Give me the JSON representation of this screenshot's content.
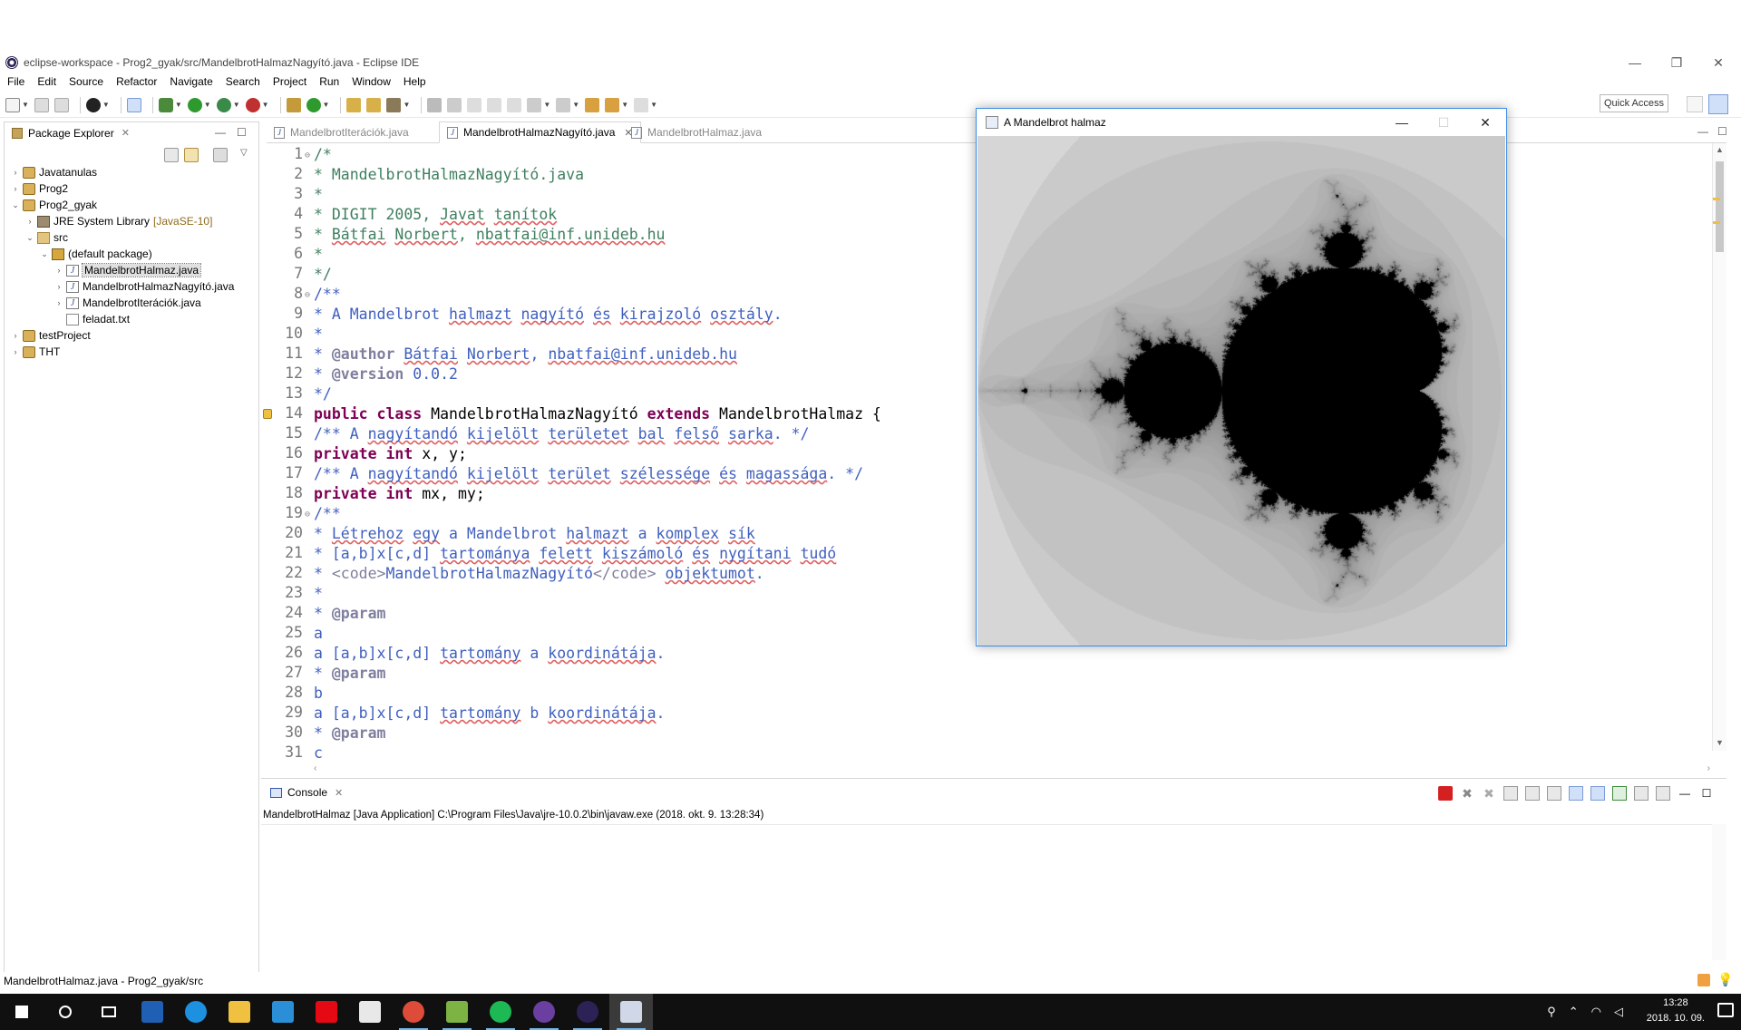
{
  "window": {
    "title": "eclipse-workspace - Prog2_gyak/src/MandelbrotHalmazNagyító.java - Eclipse IDE",
    "minimize": "—",
    "restore": "❐",
    "close": "✕"
  },
  "menu": [
    "File",
    "Edit",
    "Source",
    "Refactor",
    "Navigate",
    "Search",
    "Project",
    "Run",
    "Window",
    "Help"
  ],
  "toolbar": {
    "quick_access": "Quick Access"
  },
  "package_explorer": {
    "title": "Package Explorer",
    "items": [
      {
        "label": "Javatanulas",
        "arrow": "›",
        "icon": "project-icon",
        "level": 0
      },
      {
        "label": "Prog2",
        "arrow": "›",
        "icon": "project-icon",
        "level": 0
      },
      {
        "label": "Prog2_gyak",
        "arrow": "⌄",
        "icon": "project-icon",
        "level": 0
      },
      {
        "label": "JRE System Library",
        "suffix": "[JavaSE-10]",
        "arrow": "›",
        "icon": "library-icon",
        "level": 1
      },
      {
        "label": "src",
        "arrow": "⌄",
        "icon": "source-folder-icon",
        "level": 1
      },
      {
        "label": "(default package)",
        "arrow": "⌄",
        "icon": "package-icon",
        "level": 2
      },
      {
        "label": "MandelbrotHalmaz.java",
        "arrow": "›",
        "icon": "java-file-icon",
        "level": 3,
        "selected": true
      },
      {
        "label": "MandelbrotHalmazNagyító.java",
        "arrow": "›",
        "icon": "java-file-icon",
        "level": 3
      },
      {
        "label": "MandelbrotIterációk.java",
        "arrow": "›",
        "icon": "java-file-icon",
        "level": 3
      },
      {
        "label": "feladat.txt",
        "arrow": "",
        "icon": "text-file-icon",
        "level": 3
      },
      {
        "label": "testProject",
        "arrow": "›",
        "icon": "project-icon",
        "level": 0
      },
      {
        "label": "THT",
        "arrow": "›",
        "icon": "project-icon",
        "level": 0
      }
    ]
  },
  "editor_tabs": [
    {
      "label": "MandelbrotIterációk.java",
      "active": false
    },
    {
      "label": "MandelbrotHalmazNagyító.java",
      "active": true
    },
    {
      "label": "MandelbrotHalmaz.java",
      "active": false
    }
  ],
  "code_lines": [
    {
      "n": "1",
      "fold": "⊖",
      "html": "<span class='cmg'>/*</span>"
    },
    {
      "n": "2",
      "html": "<span class='cmg'>* MandelbrotHalmazNagyító.java</span>"
    },
    {
      "n": "3",
      "html": "<span class='cmg'>*</span>"
    },
    {
      "n": "4",
      "html": "<span class='cmg'>* DIGIT 2005, <span class='sq'>Javat</span> <span class='sq'>tanítok</span></span>"
    },
    {
      "n": "5",
      "html": "<span class='cmg'>* <span class='sq'>Bátfai</span> <span class='sq'>Norbert</span>, <span class='sq'>nbatfai@inf.unideb.hu</span></span>"
    },
    {
      "n": "6",
      "html": "<span class='cmg'>*</span>"
    },
    {
      "n": "7",
      "html": "<span class='cmg'>*/</span>"
    },
    {
      "n": "8",
      "fold": "⊖",
      "html": "<span class='cm'>/**</span>"
    },
    {
      "n": "9",
      "html": "<span class='cm'>* A Mandelbrot <span class='sq'>halmazt</span> <span class='sq'>nagyító</span> <span class='sq'>és</span> <span class='sq'>kirajzoló</span> <span class='sq'>osztály</span>.</span>"
    },
    {
      "n": "10",
      "html": "<span class='cm'>*</span>"
    },
    {
      "n": "11",
      "html": "<span class='cm'>* <b class='tag'>@author</b> <span class='sq'>Bátfai</span> <span class='sq'>Norbert</span>, <span class='sq'>nbatfai@inf.unideb.hu</span></span>"
    },
    {
      "n": "12",
      "html": "<span class='cm'>* <b class='tag'>@version</b> 0.0.2</span>"
    },
    {
      "n": "13",
      "html": "<span class='cm'>*/</span>"
    },
    {
      "n": "14",
      "marker": true,
      "html": "<span class='kw'>public</span> <span class='kw'>class</span> MandelbrotHalmazNagyító <span class='kw'>extends</span> MandelbrotHalmaz {"
    },
    {
      "n": "15",
      "html": "<span class='cm'>/** A <span class='sq'>nagyítandó</span> <span class='sq'>kijelölt</span> <span class='sq'>területet</span> <span class='sq'>bal</span> <span class='sq'>felső</span> <span class='sq'>sarka</span>. */</span>"
    },
    {
      "n": "16",
      "html": "<span class='kw'>private</span> <span class='kw'>int</span> x, y;"
    },
    {
      "n": "17",
      "html": "<span class='cm'>/** A <span class='sq'>nagyítandó</span> <span class='sq'>kijelölt</span> <span class='sq'>terület</span> <span class='sq'>szélessége</span> <span class='sq'>és</span> <span class='sq'>magassága</span>. */</span>"
    },
    {
      "n": "18",
      "html": "<span class='kw'>private</span> <span class='kw'>int</span> mx, my;"
    },
    {
      "n": "19",
      "fold": "⊖",
      "html": "<span class='cm'>/**</span>"
    },
    {
      "n": "20",
      "html": "<span class='cm'>* <span class='sq'>Létrehoz</span> <span class='sq'>egy</span> a Mandelbrot <span class='sq'>halmazt</span> a <span class='sq'>komplex</span> <span class='sq'>sík</span></span>"
    },
    {
      "n": "21",
      "html": "<span class='cm'>* [a,b]x[c,d] <span class='sq'>tartománya</span> <span class='sq'>felett</span> <span class='sq'>kiszámoló</span> <span class='sq'>és</span> <span class='sq'>nygítani</span> <span class='sq'>tudó</span></span>"
    },
    {
      "n": "22",
      "html": "<span class='cm'>* <span class='tag'>&lt;code&gt;</span>MandelbrotHalmazNagyító<span class='tag'>&lt;/code&gt;</span> <span class='sq'>objektumot</span>.</span>"
    },
    {
      "n": "23",
      "html": "<span class='cm'>*</span>"
    },
    {
      "n": "24",
      "html": "<span class='cm'>* <b class='tag'>@param</b></span>"
    },
    {
      "n": "25",
      "html": "<span class='cm'>a</span>"
    },
    {
      "n": "26",
      "html": "<span class='cm'>a [a,b]x[c,d] <span class='sq'>tartomány</span> a <span class='sq'>koordinátája</span>.</span>"
    },
    {
      "n": "27",
      "html": "<span class='cm'>* <b class='tag'>@param</b></span>"
    },
    {
      "n": "28",
      "html": "<span class='cm'>b</span>"
    },
    {
      "n": "29",
      "html": "<span class='cm'>a [a,b]x[c,d] <span class='sq'>tartomány</span> b <span class='sq'>koordinátája</span>.</span>"
    },
    {
      "n": "30",
      "html": "<span class='cm'>* <b class='tag'>@param</b></span>"
    },
    {
      "n": "31",
      "html": "<span class='cm'>c</span>"
    }
  ],
  "console": {
    "title": "Console",
    "description": "MandelbrotHalmaz [Java Application] C:\\Program Files\\Java\\jre-10.0.2\\bin\\javaw.exe (2018. okt. 9. 13:28:34)"
  },
  "status_bar": {
    "text": "MandelbrotHalmaz.java - Prog2_gyak/src"
  },
  "mandel_window": {
    "title": "A Mandelbrot halmaz",
    "minimize": "—",
    "maximize": "☐",
    "close": "✕"
  },
  "taskbar": {
    "apps": [
      {
        "name": "start-button",
        "color": "#ffffff"
      },
      {
        "name": "search-icon",
        "color": "#ffffff"
      },
      {
        "name": "task-view-icon",
        "color": "#ffffff"
      },
      {
        "name": "app-b-icon",
        "color": "#1f5fb4"
      },
      {
        "name": "edge-icon",
        "color": "#1e90e0"
      },
      {
        "name": "file-explorer-icon",
        "color": "#f0c040"
      },
      {
        "name": "store-icon",
        "color": "#2b8fd8"
      },
      {
        "name": "netflix-icon",
        "color": "#e50914"
      },
      {
        "name": "mail-icon",
        "color": "#e8e8e8"
      },
      {
        "name": "chrome-icon",
        "color": "#dd4b39"
      },
      {
        "name": "notepad-icon",
        "color": "#7cb342"
      },
      {
        "name": "spotify-icon",
        "color": "#1db954"
      },
      {
        "name": "app-purple-icon",
        "color": "#6b3fa0"
      },
      {
        "name": "eclipse-icon",
        "color": "#2c2255"
      },
      {
        "name": "java-icon",
        "color": "#d0d8e8"
      }
    ],
    "time": "13:28",
    "date": "2018. 10. 09."
  }
}
